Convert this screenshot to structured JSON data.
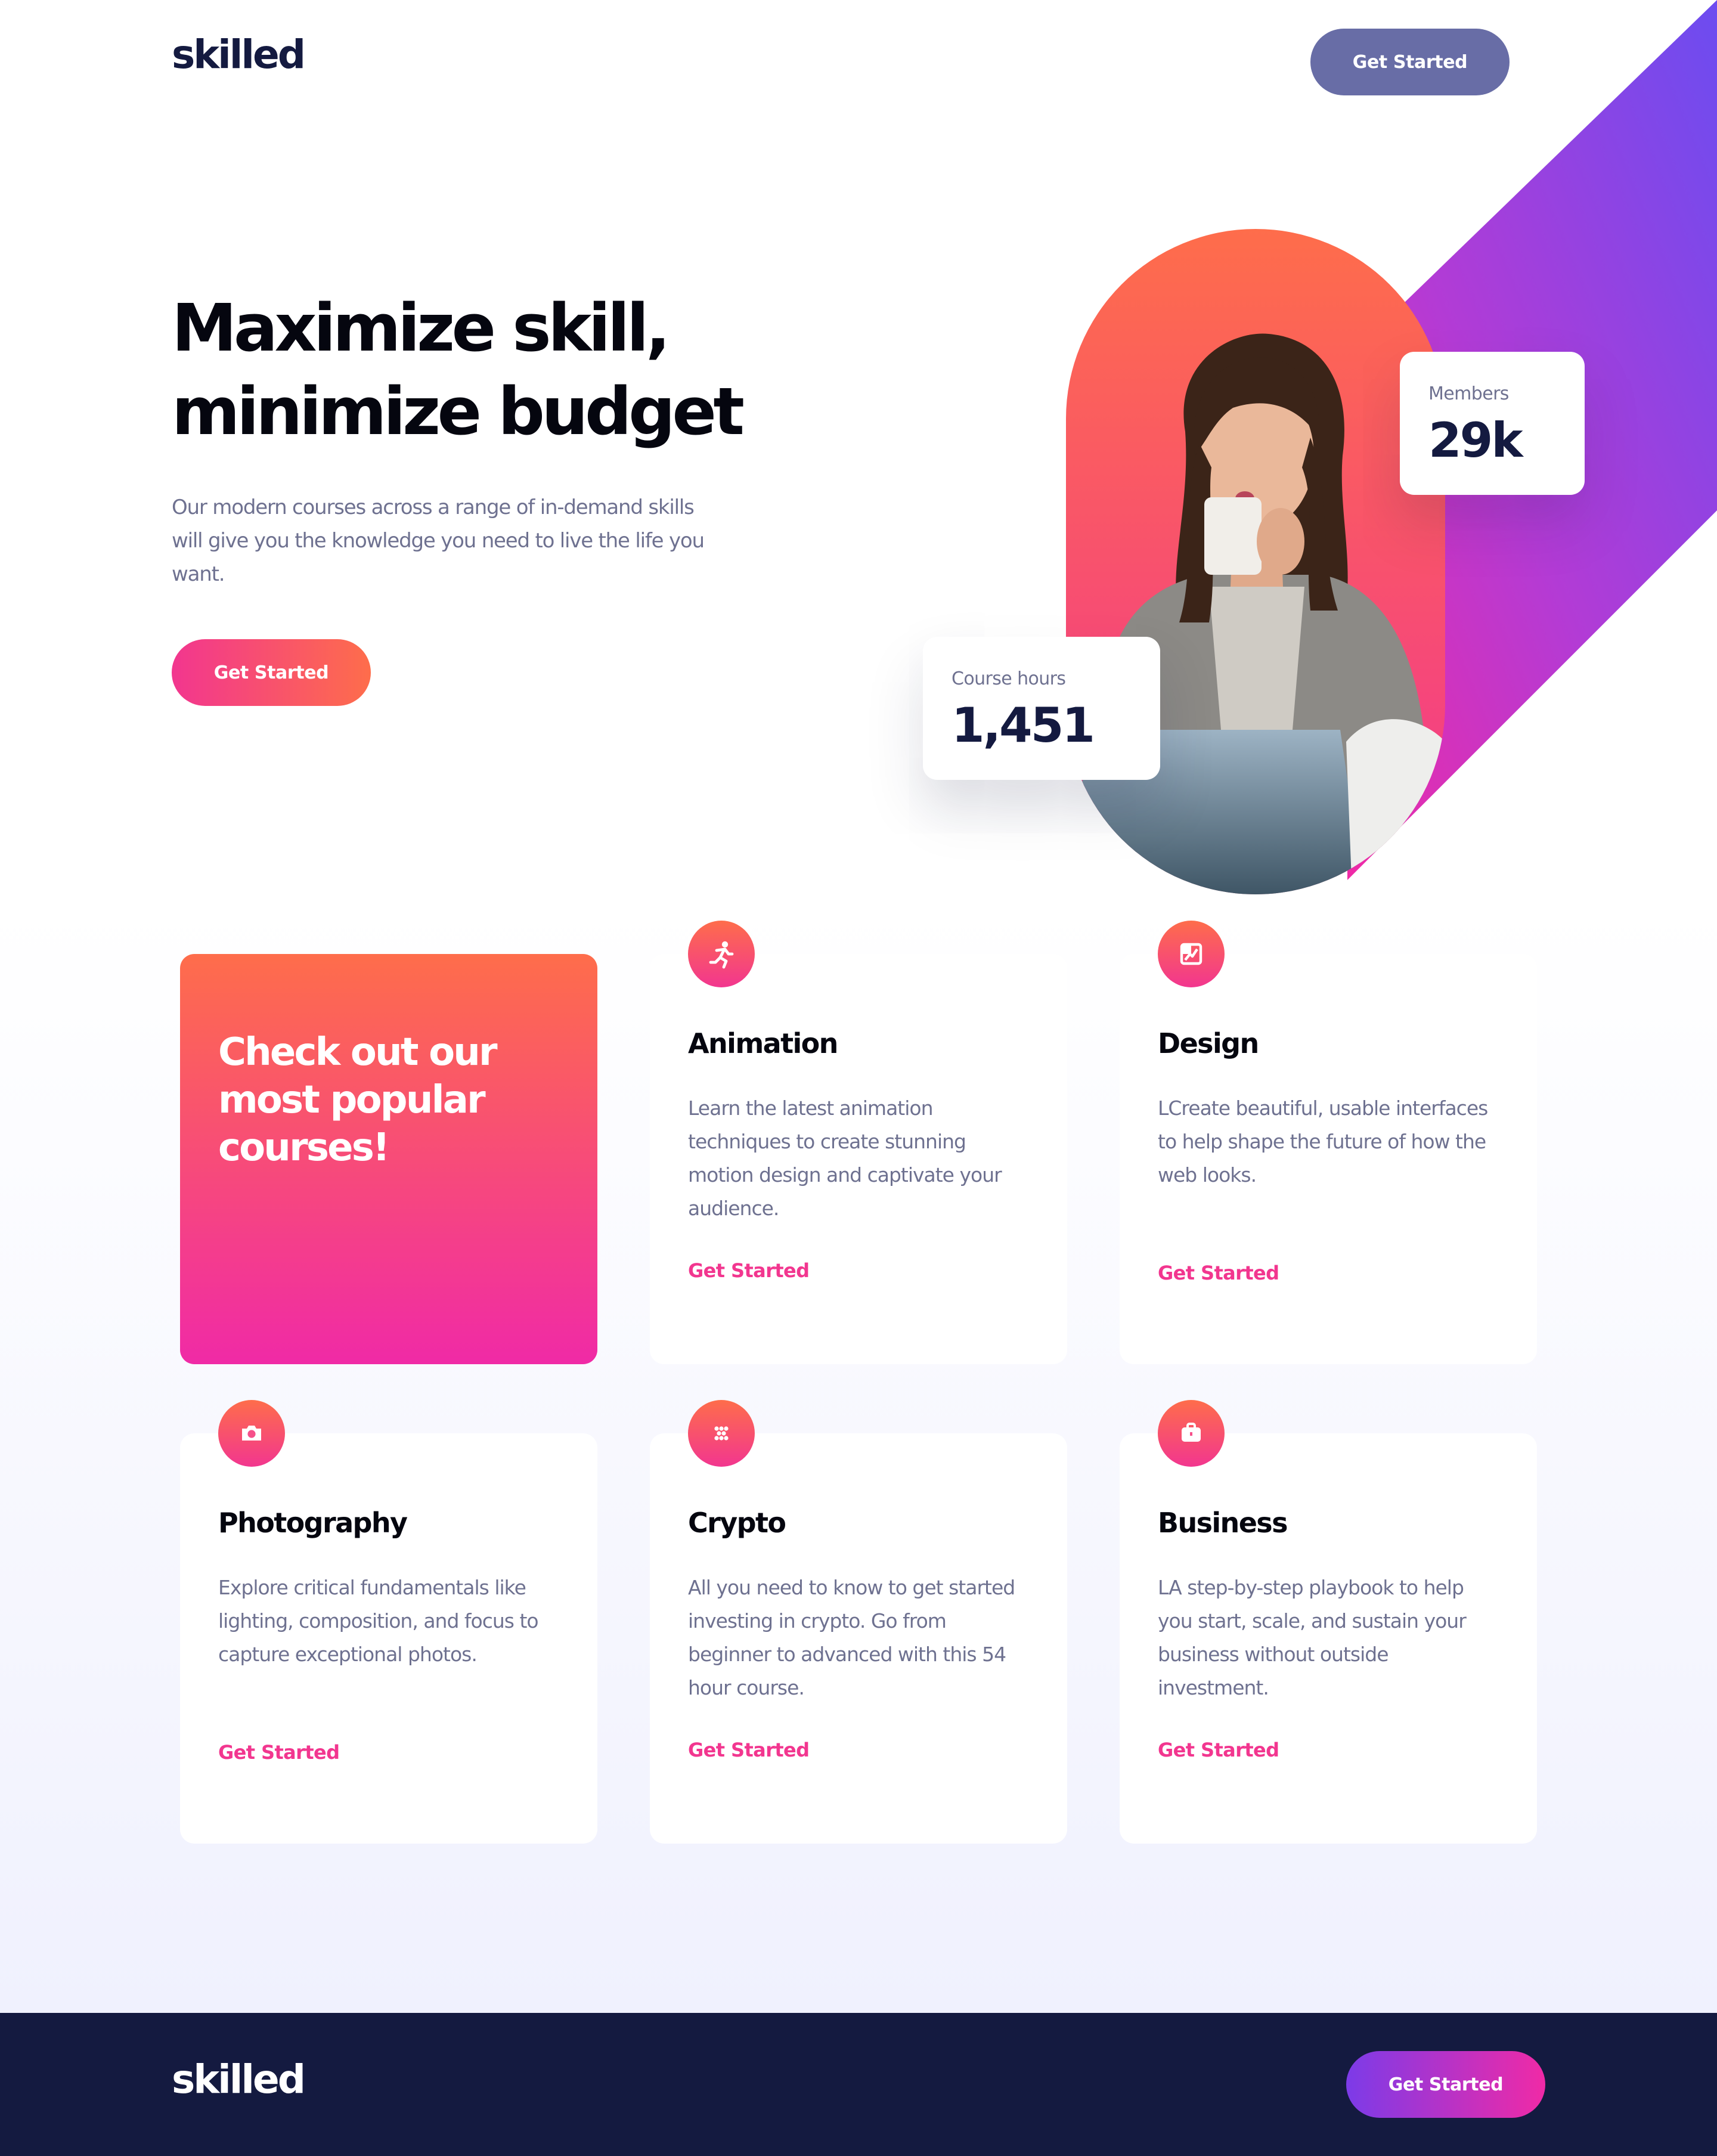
{
  "header": {
    "logo": "skilled",
    "cta_label": "Get Started"
  },
  "hero": {
    "title_lines": [
      "Maximize skill,",
      "minimize budget"
    ],
    "description": "Our modern courses across a range of in-demand skills will give you the knowledge you need to live the life you want.",
    "cta_label": "Get Started"
  },
  "stats": {
    "members": {
      "label": "Members",
      "value": "29k"
    },
    "course_hours": {
      "label": "Course hours",
      "value": "1,451"
    }
  },
  "promo": {
    "title": "Check out our most popular courses!"
  },
  "courses": [
    {
      "icon": "running-person-icon",
      "title": "Animation",
      "description": "Learn the latest animation techniques to create stunning motion design and captivate your audience.",
      "link_label": "Get Started"
    },
    {
      "icon": "design-frame-icon",
      "title": "Design",
      "description": "LCreate beautiful, usable interfaces to help shape the future of how the web looks.",
      "link_label": "Get Started"
    },
    {
      "icon": "camera-icon",
      "title": "Photography",
      "description": "Explore critical fundamentals like lighting, composition, and focus to capture exceptional photos.",
      "link_label": "Get Started"
    },
    {
      "icon": "crypto-dots-icon",
      "title": "Crypto",
      "description": "All you need to know to get started investing in crypto. Go from beginner to advanced with this 54 hour course.",
      "link_label": "Get Started"
    },
    {
      "icon": "briefcase-icon",
      "title": "Business",
      "description": "LA step-by-step playbook to help you start, scale, and sustain your business without outside investment.",
      "link_label": "Get Started"
    }
  ],
  "footer": {
    "logo": "skilled",
    "cta_label": "Get Started"
  },
  "colors": {
    "navy": "#141a40",
    "accent_pink": "#f2368f",
    "accent_orange": "#fe6d4b",
    "accent_purple": "#7c3be8",
    "header_button": "#686da6",
    "body_text": "#6e7190"
  }
}
